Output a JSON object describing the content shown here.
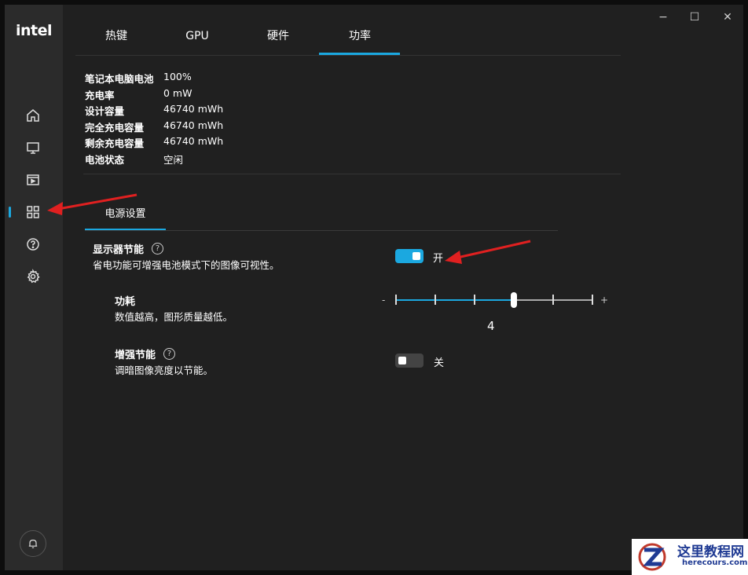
{
  "brand": {
    "logo_text": "intel"
  },
  "window_controls": {
    "minimize": "−",
    "maximize": "☐",
    "close": "✕"
  },
  "sidebar": {
    "items": [
      {
        "name": "home",
        "icon": "home-icon"
      },
      {
        "name": "display",
        "icon": "monitor-icon"
      },
      {
        "name": "video",
        "icon": "video-icon"
      },
      {
        "name": "system",
        "icon": "grid-icon",
        "active": true
      },
      {
        "name": "help",
        "icon": "question-icon"
      },
      {
        "name": "settings",
        "icon": "gear-icon"
      }
    ],
    "bell_icon": "bell-icon"
  },
  "tabs": [
    {
      "label": "热键"
    },
    {
      "label": "GPU"
    },
    {
      "label": "硬件"
    },
    {
      "label": "功率",
      "active": true
    }
  ],
  "battery_info": [
    {
      "key": "笔记本电脑电池",
      "value": "100%"
    },
    {
      "key": "充电率",
      "value": "0 mW"
    },
    {
      "key": "设计容量",
      "value": "46740 mWh"
    },
    {
      "key": "完全充电容量",
      "value": "46740 mWh"
    },
    {
      "key": "剩余充电容量",
      "value": "46740 mWh"
    },
    {
      "key": "电池状态",
      "value": "空闲"
    }
  ],
  "subtab": {
    "label": "电源设置"
  },
  "display_power_saving": {
    "title": "显示器节能",
    "help": "?",
    "description": "省电功能可增强电池模式下的图像可视性。",
    "toggle_state": "on",
    "toggle_label": "开"
  },
  "power": {
    "title": "功耗",
    "description": "数值越高，图形质量越低。",
    "minus": "-",
    "plus": "+",
    "value": "4",
    "level_fraction": 0.6
  },
  "enhanced_power_saving": {
    "title": "增强节能",
    "help": "?",
    "description": "调暗图像亮度以节能。",
    "toggle_state": "off",
    "toggle_label": "关"
  },
  "watermark": {
    "cn": "这里教程网",
    "en": "herecours.com"
  },
  "colors": {
    "accent": "#1ba8e0",
    "background": "#202020",
    "sidebar": "#2b2b2b",
    "annotation_arrow": "#e02020"
  }
}
